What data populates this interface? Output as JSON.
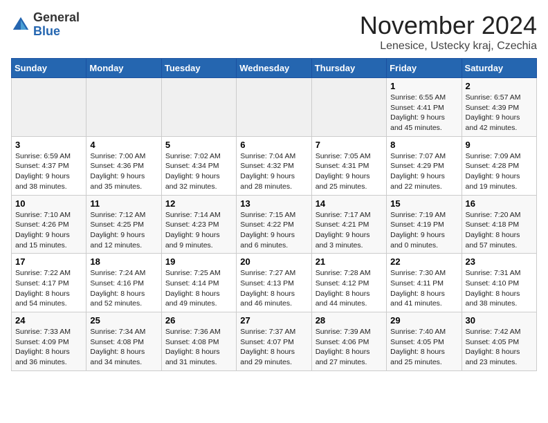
{
  "logo": {
    "text_general": "General",
    "text_blue": "Blue"
  },
  "header": {
    "month": "November 2024",
    "location": "Lenesice, Ustecky kraj, Czechia"
  },
  "days_of_week": [
    "Sunday",
    "Monday",
    "Tuesday",
    "Wednesday",
    "Thursday",
    "Friday",
    "Saturday"
  ],
  "weeks": [
    [
      {
        "day": "",
        "info": ""
      },
      {
        "day": "",
        "info": ""
      },
      {
        "day": "",
        "info": ""
      },
      {
        "day": "",
        "info": ""
      },
      {
        "day": "",
        "info": ""
      },
      {
        "day": "1",
        "info": "Sunrise: 6:55 AM\nSunset: 4:41 PM\nDaylight: 9 hours and 45 minutes."
      },
      {
        "day": "2",
        "info": "Sunrise: 6:57 AM\nSunset: 4:39 PM\nDaylight: 9 hours and 42 minutes."
      }
    ],
    [
      {
        "day": "3",
        "info": "Sunrise: 6:59 AM\nSunset: 4:37 PM\nDaylight: 9 hours and 38 minutes."
      },
      {
        "day": "4",
        "info": "Sunrise: 7:00 AM\nSunset: 4:36 PM\nDaylight: 9 hours and 35 minutes."
      },
      {
        "day": "5",
        "info": "Sunrise: 7:02 AM\nSunset: 4:34 PM\nDaylight: 9 hours and 32 minutes."
      },
      {
        "day": "6",
        "info": "Sunrise: 7:04 AM\nSunset: 4:32 PM\nDaylight: 9 hours and 28 minutes."
      },
      {
        "day": "7",
        "info": "Sunrise: 7:05 AM\nSunset: 4:31 PM\nDaylight: 9 hours and 25 minutes."
      },
      {
        "day": "8",
        "info": "Sunrise: 7:07 AM\nSunset: 4:29 PM\nDaylight: 9 hours and 22 minutes."
      },
      {
        "day": "9",
        "info": "Sunrise: 7:09 AM\nSunset: 4:28 PM\nDaylight: 9 hours and 19 minutes."
      }
    ],
    [
      {
        "day": "10",
        "info": "Sunrise: 7:10 AM\nSunset: 4:26 PM\nDaylight: 9 hours and 15 minutes."
      },
      {
        "day": "11",
        "info": "Sunrise: 7:12 AM\nSunset: 4:25 PM\nDaylight: 9 hours and 12 minutes."
      },
      {
        "day": "12",
        "info": "Sunrise: 7:14 AM\nSunset: 4:23 PM\nDaylight: 9 hours and 9 minutes."
      },
      {
        "day": "13",
        "info": "Sunrise: 7:15 AM\nSunset: 4:22 PM\nDaylight: 9 hours and 6 minutes."
      },
      {
        "day": "14",
        "info": "Sunrise: 7:17 AM\nSunset: 4:21 PM\nDaylight: 9 hours and 3 minutes."
      },
      {
        "day": "15",
        "info": "Sunrise: 7:19 AM\nSunset: 4:19 PM\nDaylight: 9 hours and 0 minutes."
      },
      {
        "day": "16",
        "info": "Sunrise: 7:20 AM\nSunset: 4:18 PM\nDaylight: 8 hours and 57 minutes."
      }
    ],
    [
      {
        "day": "17",
        "info": "Sunrise: 7:22 AM\nSunset: 4:17 PM\nDaylight: 8 hours and 54 minutes."
      },
      {
        "day": "18",
        "info": "Sunrise: 7:24 AM\nSunset: 4:16 PM\nDaylight: 8 hours and 52 minutes."
      },
      {
        "day": "19",
        "info": "Sunrise: 7:25 AM\nSunset: 4:14 PM\nDaylight: 8 hours and 49 minutes."
      },
      {
        "day": "20",
        "info": "Sunrise: 7:27 AM\nSunset: 4:13 PM\nDaylight: 8 hours and 46 minutes."
      },
      {
        "day": "21",
        "info": "Sunrise: 7:28 AM\nSunset: 4:12 PM\nDaylight: 8 hours and 44 minutes."
      },
      {
        "day": "22",
        "info": "Sunrise: 7:30 AM\nSunset: 4:11 PM\nDaylight: 8 hours and 41 minutes."
      },
      {
        "day": "23",
        "info": "Sunrise: 7:31 AM\nSunset: 4:10 PM\nDaylight: 8 hours and 38 minutes."
      }
    ],
    [
      {
        "day": "24",
        "info": "Sunrise: 7:33 AM\nSunset: 4:09 PM\nDaylight: 8 hours and 36 minutes."
      },
      {
        "day": "25",
        "info": "Sunrise: 7:34 AM\nSunset: 4:08 PM\nDaylight: 8 hours and 34 minutes."
      },
      {
        "day": "26",
        "info": "Sunrise: 7:36 AM\nSunset: 4:08 PM\nDaylight: 8 hours and 31 minutes."
      },
      {
        "day": "27",
        "info": "Sunrise: 7:37 AM\nSunset: 4:07 PM\nDaylight: 8 hours and 29 minutes."
      },
      {
        "day": "28",
        "info": "Sunrise: 7:39 AM\nSunset: 4:06 PM\nDaylight: 8 hours and 27 minutes."
      },
      {
        "day": "29",
        "info": "Sunrise: 7:40 AM\nSunset: 4:05 PM\nDaylight: 8 hours and 25 minutes."
      },
      {
        "day": "30",
        "info": "Sunrise: 7:42 AM\nSunset: 4:05 PM\nDaylight: 8 hours and 23 minutes."
      }
    ]
  ]
}
